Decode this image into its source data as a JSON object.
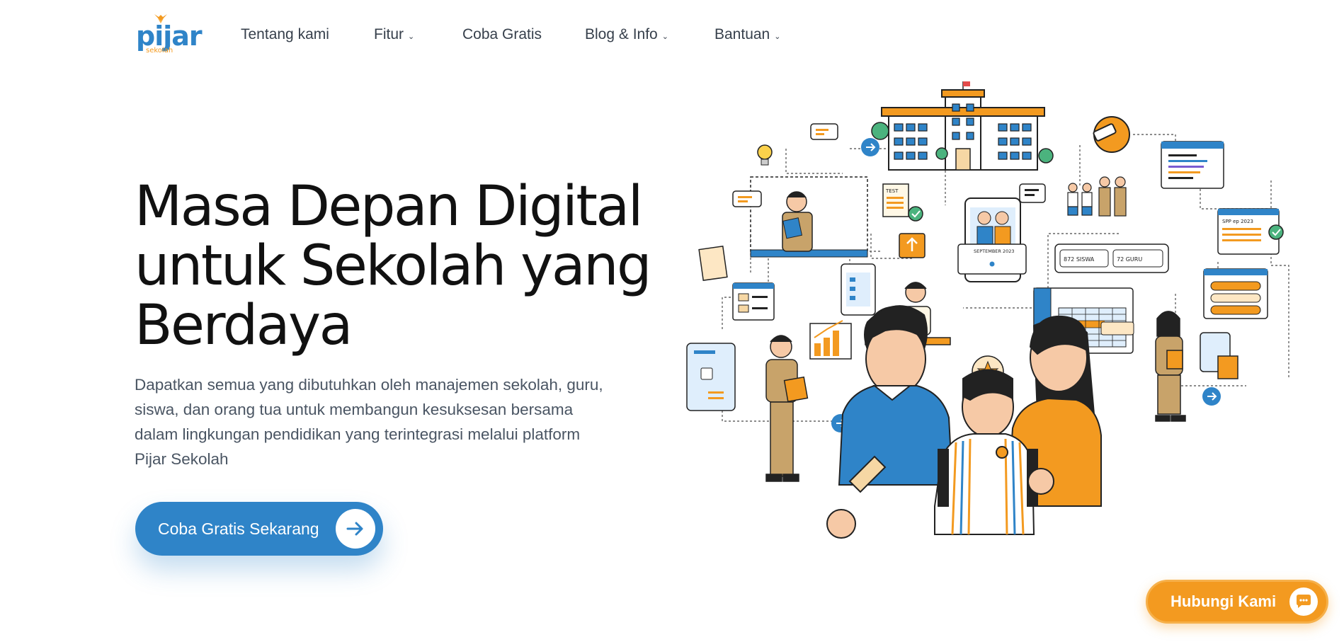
{
  "brand": {
    "logo_text": "pijar",
    "logo_subtext": "sekolah",
    "primary_color": "#2f84c8",
    "accent_color": "#f39a20"
  },
  "nav": {
    "items": [
      {
        "label": "Tentang kami",
        "has_dropdown": false
      },
      {
        "label": "Fitur",
        "has_dropdown": true
      },
      {
        "label": "Coba Gratis",
        "has_dropdown": false
      },
      {
        "label": "Blog & Info",
        "has_dropdown": true
      },
      {
        "label": "Bantuan",
        "has_dropdown": true
      }
    ]
  },
  "hero": {
    "title_line1": "Masa Depan Digital",
    "title_line2": "untuk Sekolah yang",
    "title_line3": "Berdaya",
    "description": "Dapatkan semua yang dibutuhkan oleh manajemen sekolah, guru, siswa, dan orang tua untuk membangun kesuksesan bersama dalam lingkungan pendidikan yang terintegrasi melalui platform Pijar Sekolah",
    "cta_label": "Coba Gratis Sekarang"
  },
  "illustration": {
    "calendar_label": "SEPTEMBER 2023",
    "students_stat": "872 SISWA",
    "teachers_stat": "72 GURU",
    "spp_label": "SPP ep 2023",
    "test_label": "TEST"
  },
  "contact": {
    "label": "Hubungi Kami"
  }
}
